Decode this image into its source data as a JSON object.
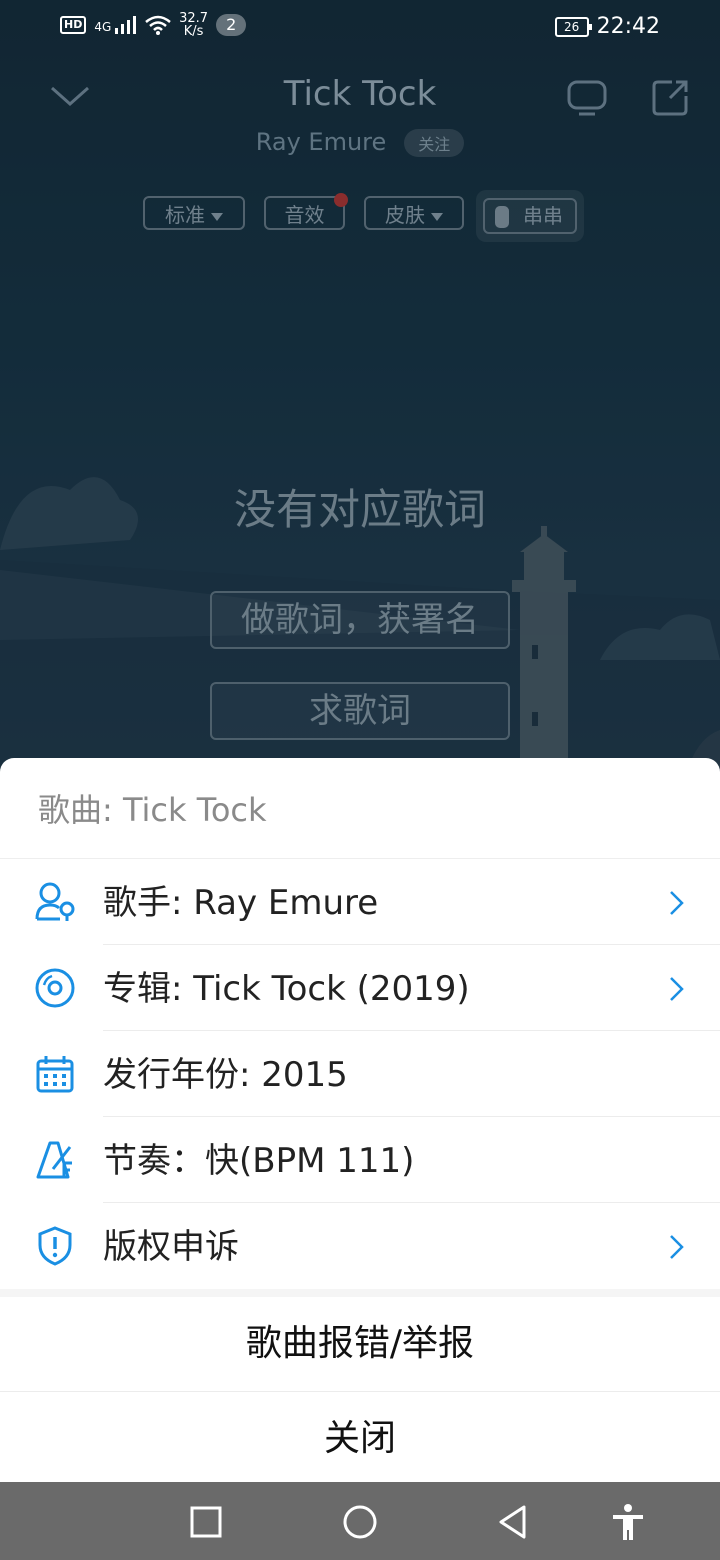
{
  "status_bar": {
    "hd": "HD",
    "signal": "4G",
    "net_speed_value": "32.7",
    "net_speed_unit": "K/s",
    "notification_count": "2",
    "battery": "26",
    "time": "22:42"
  },
  "player": {
    "title": "Tick Tock",
    "artist": "Ray Emure",
    "follow_label": "关注",
    "chips": {
      "quality": "标准",
      "effects": "音效",
      "skin": "皮肤",
      "chuanchuan": "串串"
    },
    "no_lyrics": "没有对应歌词",
    "make_lyrics_button": "做歌词，获署名",
    "request_lyrics_button": "求歌词"
  },
  "sheet": {
    "title": "歌曲: Tick Tock",
    "rows": [
      {
        "label": "歌手: Ray Emure",
        "icon": "singer-icon",
        "has_arrow": true
      },
      {
        "label": "专辑: Tick Tock (2019)",
        "icon": "album-icon",
        "has_arrow": true
      },
      {
        "label": "发行年份: 2015",
        "icon": "calendar-icon",
        "has_arrow": false
      },
      {
        "label": "节奏：快(BPM 111)",
        "icon": "metronome-icon",
        "has_arrow": false
      },
      {
        "label": "版权申诉",
        "icon": "shield-icon",
        "has_arrow": true
      }
    ],
    "report_button": "歌曲报错/举报",
    "close_button": "关闭"
  },
  "colors": {
    "accent": "#1a8fe3",
    "player_bg": "#1a3a4c",
    "navbar_bg": "#6a6a6a"
  }
}
